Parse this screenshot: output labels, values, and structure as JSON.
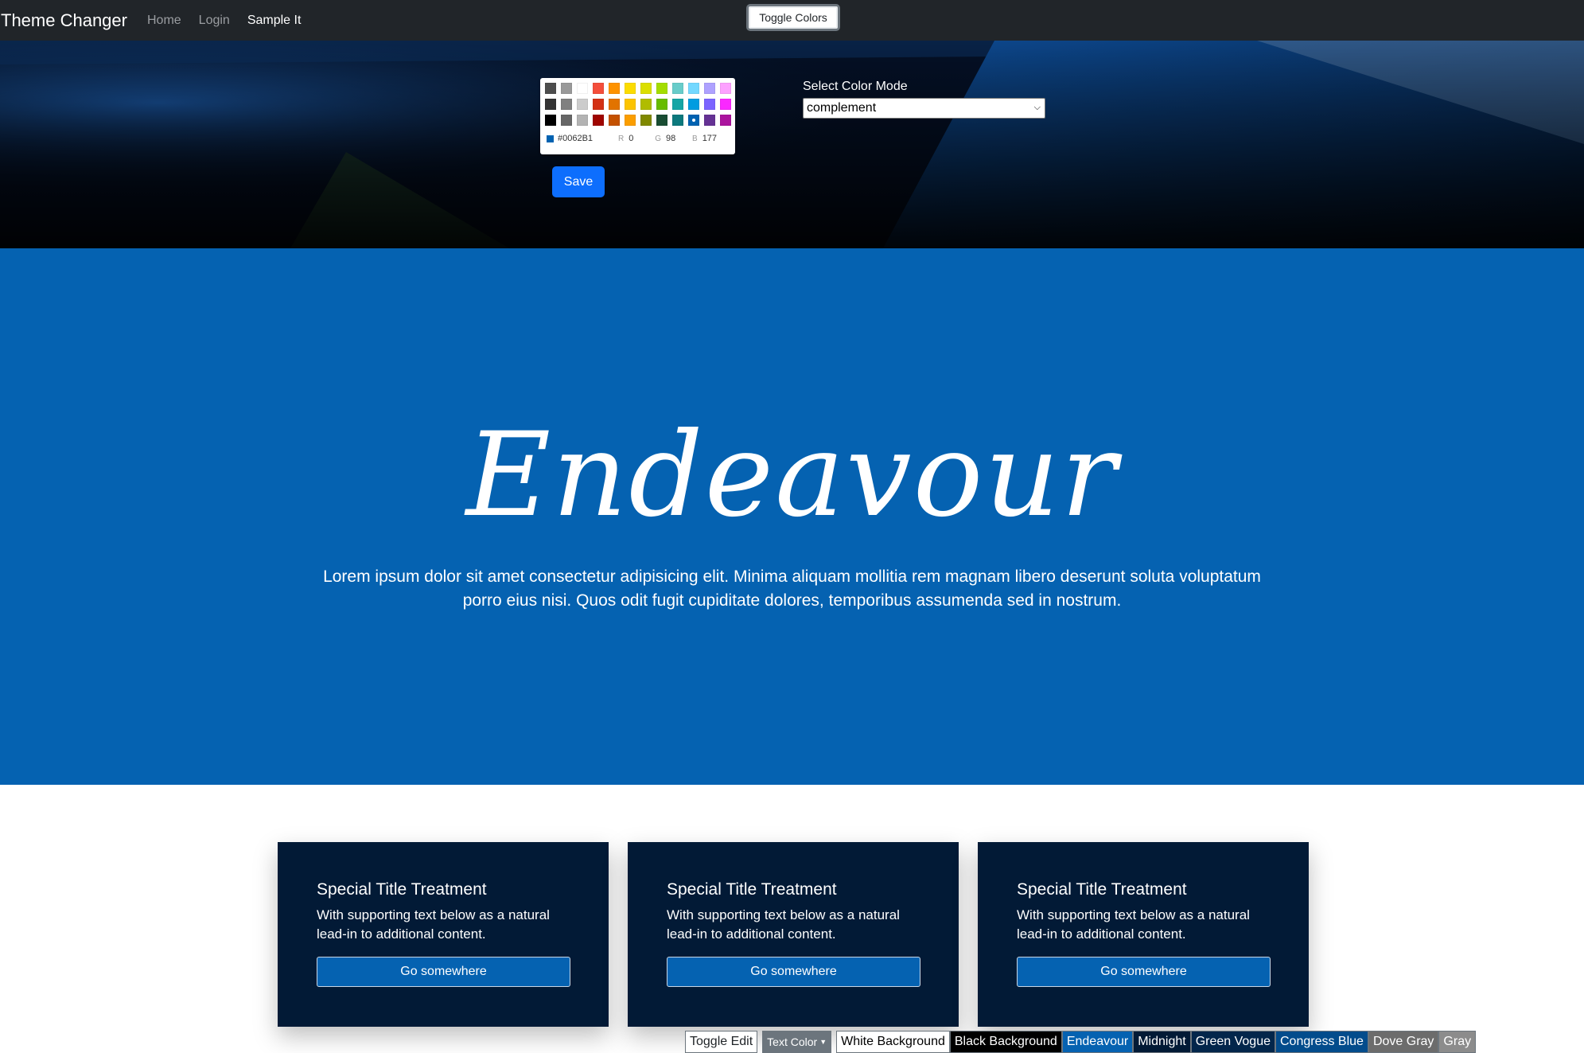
{
  "navbar": {
    "brand": "Theme Changer",
    "links": [
      "Home",
      "Login",
      "Sample It"
    ],
    "toggle_colors_label": "Toggle Colors"
  },
  "picker": {
    "swatches": [
      "#4d4d4d",
      "#999999",
      "#ffffff",
      "#f44e3b",
      "#fe9200",
      "#fcdc00",
      "#dbdf00",
      "#a4dd00",
      "#68ccca",
      "#73d8ff",
      "#aea1ff",
      "#fda1ff",
      "#333333",
      "#808080",
      "#cccccc",
      "#d33115",
      "#e27300",
      "#fcc400",
      "#b0bc00",
      "#68bc00",
      "#16a5a5",
      "#009ce0",
      "#7b64ff",
      "#fa28ff",
      "#000000",
      "#666666",
      "#b3b3b3",
      "#9f0500",
      "#c45100",
      "#fb9e00",
      "#808900",
      "#194d33",
      "#0c797d",
      "#0062b1",
      "#653294",
      "#ab149e"
    ],
    "selected_index": 33,
    "current_color": "#0062B1",
    "hex": "#0062B1",
    "r_label": "R",
    "r": "0",
    "g_label": "G",
    "g": "98",
    "b_label": "B",
    "b": "177"
  },
  "save_label": "Save",
  "color_mode": {
    "label": "Select Color Mode",
    "selected": "complement"
  },
  "hero": {
    "title": "Endeavour",
    "text": "Lorem ipsum dolor sit amet consectetur adipisicing elit. Minima aliquam mollitia rem magnam libero deserunt soluta voluptatum porro eius nisi. Quos odit fugit cupiditate dolores, temporibus assumenda sed in nostrum."
  },
  "cards": [
    {
      "title": "Special Title Treatment",
      "text": "With supporting text below as a natural lead-in to additional content.",
      "button": "Go somewhere"
    },
    {
      "title": "Special Title Treatment",
      "text": "With supporting text below as a natural lead-in to additional content.",
      "button": "Go somewhere"
    },
    {
      "title": "Special Title Treatment",
      "text": "With supporting text below as a natural lead-in to additional content.",
      "button": "Go somewhere"
    }
  ],
  "toolbar": {
    "toggle_edit": "Toggle Edit",
    "text_color": "Text Color",
    "themes": [
      {
        "label": "White Background",
        "bg": "#ffffff",
        "fg": "#000000"
      },
      {
        "label": "Black Background",
        "bg": "#000000",
        "fg": "#ffffff"
      },
      {
        "label": "Endeavour",
        "bg": "#0562b1",
        "fg": "#ffffff"
      },
      {
        "label": "Midnight",
        "bg": "#021a36",
        "fg": "#ffffff"
      },
      {
        "label": "Green Vogue",
        "bg": "#03264b",
        "fg": "#ffffff"
      },
      {
        "label": "Congress Blue",
        "bg": "#034c8c",
        "fg": "#ffffff"
      },
      {
        "label": "Dove Gray",
        "bg": "#6c6c6c",
        "fg": "#ffffff"
      },
      {
        "label": "Gray",
        "bg": "#8c8c8c",
        "fg": "#ffffff"
      }
    ]
  }
}
